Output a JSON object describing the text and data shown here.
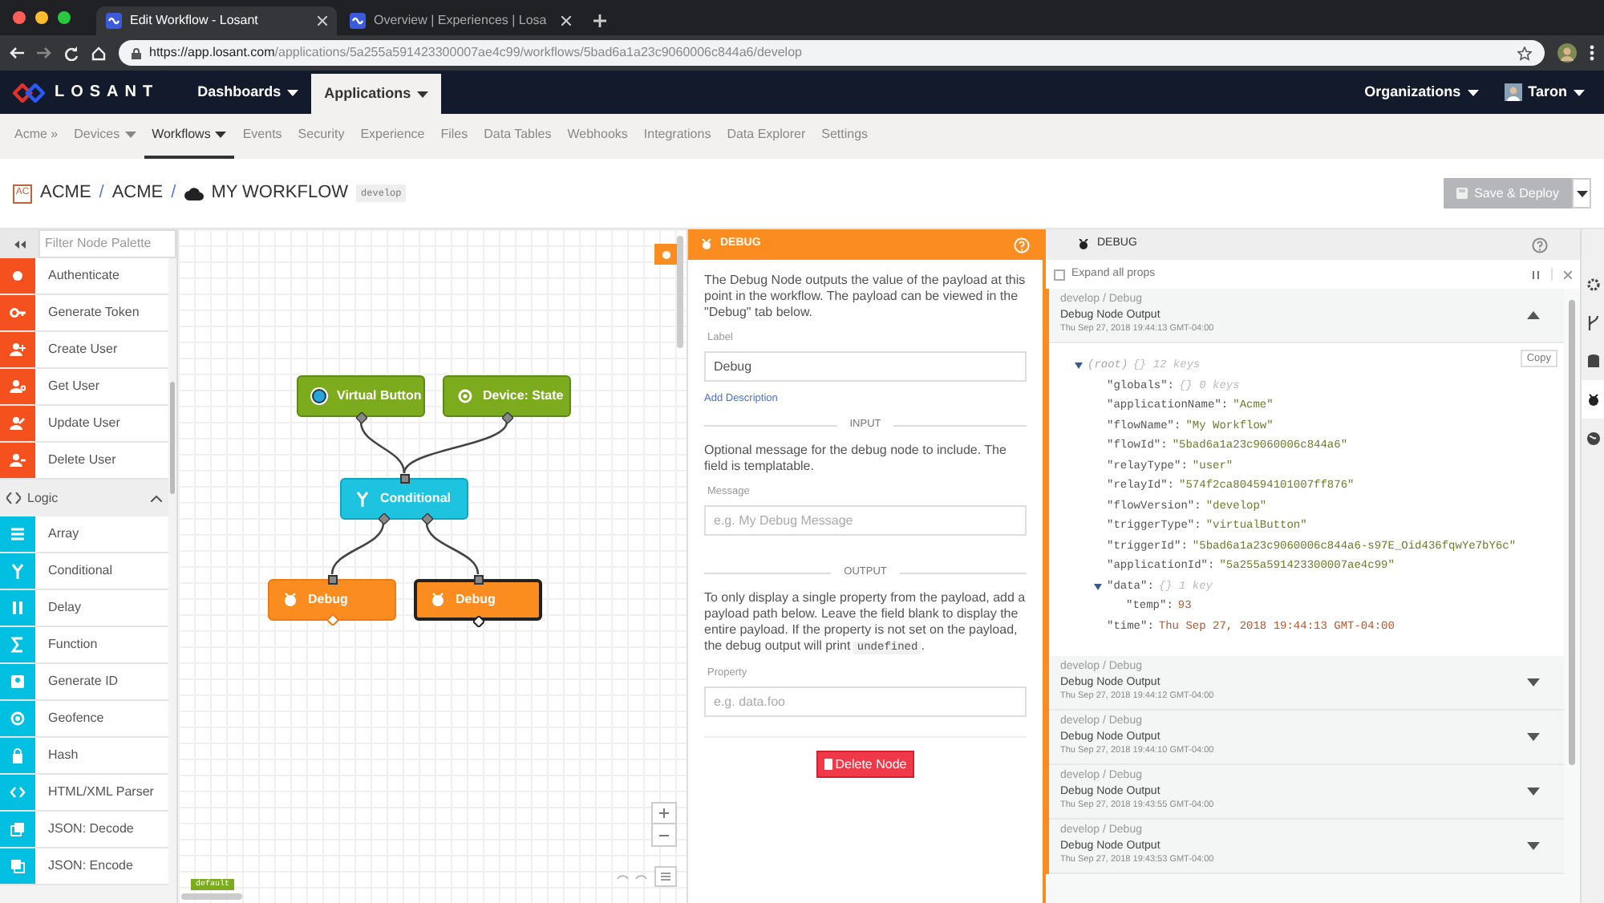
{
  "browser": {
    "tabs": [
      {
        "title": "Edit Workflow - Losant",
        "selected": true
      },
      {
        "title": "Overview | Experiences | Losa",
        "selected": false
      }
    ],
    "url_host": "https://app.losant.com",
    "url_path": "/applications/5a255a591423300007ae4c99/workflows/5bad6a1a23c9060006c844a6/develop"
  },
  "nav": {
    "logo": "LOSANT",
    "menus": [
      {
        "label": "Dashboards",
        "selected": false
      },
      {
        "label": "Applications",
        "selected": true
      }
    ],
    "organizations": "Organizations",
    "user": "Taron"
  },
  "subnav": [
    {
      "label": "Acme »",
      "dropdown": false,
      "selected": false
    },
    {
      "label": "Devices",
      "dropdown": true,
      "selected": false
    },
    {
      "label": "Workflows",
      "dropdown": true,
      "selected": true
    },
    {
      "label": "Events",
      "dropdown": false,
      "selected": false
    },
    {
      "label": "Security",
      "dropdown": false,
      "selected": false
    },
    {
      "label": "Experience",
      "dropdown": false,
      "selected": false
    },
    {
      "label": "Files",
      "dropdown": false,
      "selected": false
    },
    {
      "label": "Data Tables",
      "dropdown": false,
      "selected": false
    },
    {
      "label": "Webhooks",
      "dropdown": false,
      "selected": false
    },
    {
      "label": "Integrations",
      "dropdown": false,
      "selected": false
    },
    {
      "label": "Data Explorer",
      "dropdown": false,
      "selected": false
    },
    {
      "label": "Settings",
      "dropdown": false,
      "selected": false
    }
  ],
  "header": {
    "badge": "AC",
    "crumbs": [
      {
        "kind": "crumb",
        "text": "ACME"
      },
      {
        "kind": "separator",
        "text": "/"
      },
      {
        "kind": "crumb",
        "text": "ACME"
      },
      {
        "kind": "separator",
        "text": "/"
      },
      {
        "kind": "current",
        "text": "MY WORKFLOW"
      }
    ],
    "version": "develop",
    "save_button": {
      "label": "Save & Deploy",
      "disabled": true
    }
  },
  "palette": {
    "filter_placeholder": "Filter Node Palette",
    "rows": [
      {
        "kind": "node",
        "label": "Authenticate",
        "color": "#f4511e"
      },
      {
        "kind": "node",
        "label": "Generate Token",
        "color": "#f4511e"
      },
      {
        "kind": "node",
        "label": "Create User",
        "color": "#f4511e"
      },
      {
        "kind": "node",
        "label": "Get User",
        "color": "#f4511e"
      },
      {
        "kind": "node",
        "label": "Update User",
        "color": "#f4511e"
      },
      {
        "kind": "node",
        "label": "Delete User",
        "color": "#f4511e"
      },
      {
        "kind": "group",
        "label": "Logic",
        "expanded": true
      },
      {
        "kind": "node",
        "label": "Array",
        "color": "#00bfe0"
      },
      {
        "kind": "node",
        "label": "Conditional",
        "color": "#00bfe0"
      },
      {
        "kind": "node",
        "label": "Delay",
        "color": "#00bfe0"
      },
      {
        "kind": "node",
        "label": "Function",
        "color": "#00bfe0"
      },
      {
        "kind": "node",
        "label": "Generate ID",
        "color": "#00bfe0"
      },
      {
        "kind": "node",
        "label": "Geofence",
        "color": "#00bfe0"
      },
      {
        "kind": "node",
        "label": "Hash",
        "color": "#00bfe0"
      },
      {
        "kind": "node",
        "label": "HTML/XML Parser",
        "color": "#00bfe0"
      },
      {
        "kind": "node",
        "label": "JSON: Decode",
        "color": "#00bfe0"
      },
      {
        "kind": "node",
        "label": "JSON: Encode",
        "color": "#00bfe0"
      }
    ]
  },
  "canvas": {
    "nodes": [
      {
        "label": "Virtual Button",
        "kind": "trigger",
        "selected": false
      },
      {
        "label": "Device: State",
        "kind": "trigger",
        "selected": false
      },
      {
        "label": "Conditional",
        "kind": "logic",
        "selected": false
      },
      {
        "label": "Debug",
        "kind": "output",
        "selected": false
      },
      {
        "label": "Debug",
        "kind": "output",
        "selected": true
      }
    ],
    "version_tag": "default"
  },
  "node_panel": {
    "title": "DEBUG",
    "description": "The Debug Node outputs the value of the payload at this point in the workflow. The payload can be viewed in the \"Debug\" tab below.",
    "label_field": {
      "label": "Label",
      "value": "Debug"
    },
    "add_description": "Add Description",
    "input_heading": "INPUT",
    "input_text": "Optional message for the debug node to include. The field is templatable.",
    "message_field": {
      "label": "Message",
      "placeholder": "e.g. My Debug Message"
    },
    "output_heading": "OUTPUT",
    "output_text": {
      "before": "To only display a single property from the payload, add a payload path below. Leave the field blank to display the entire payload. If the property is not set on the payload, the debug output will print ",
      "code": "undefined",
      "after": "."
    },
    "property_field": {
      "label": "Property",
      "placeholder": "e.g. data.foo"
    },
    "delete_button": "Delete Node"
  },
  "debug_panel": {
    "title": "DEBUG",
    "expand_all": {
      "label": "Expand all props",
      "checked": false
    },
    "copy_button": "Copy",
    "entries": [
      {
        "path": "develop / Debug",
        "title": "Debug Node Output",
        "time": "Thu Sep 27, 2018 19:44:13 GMT-04:00",
        "expanded": true
      },
      {
        "path": "develop / Debug",
        "title": "Debug Node Output",
        "time": "Thu Sep 27, 2018 19:44:12 GMT-04:00",
        "expanded": false
      },
      {
        "path": "develop / Debug",
        "title": "Debug Node Output",
        "time": "Thu Sep 27, 2018 19:44:10 GMT-04:00",
        "expanded": false
      },
      {
        "path": "develop / Debug",
        "title": "Debug Node Output",
        "time": "Thu Sep 27, 2018 19:43:55 GMT-04:00",
        "expanded": false
      },
      {
        "path": "develop / Debug",
        "title": "Debug Node Output",
        "time": "Thu Sep 27, 2018 19:43:53 GMT-04:00",
        "expanded": false
      }
    ],
    "tree": {
      "key": "(root)",
      "summary": "{} 12 keys",
      "expanded": true,
      "children": [
        {
          "key": "\"globals\":",
          "summary": "{} 0 keys"
        },
        {
          "key": "\"applicationName\":",
          "value": "\"Acme\"",
          "kind": "string"
        },
        {
          "key": "\"flowName\":",
          "value": "\"My Workflow\"",
          "kind": "string"
        },
        {
          "key": "\"flowId\":",
          "value": "\"5bad6a1a23c9060006c844a6\"",
          "kind": "string"
        },
        {
          "key": "\"relayType\":",
          "value": "\"user\"",
          "kind": "string"
        },
        {
          "key": "\"relayId\":",
          "value": "\"574f2ca804594101007ff876\"",
          "kind": "string"
        },
        {
          "key": "\"flowVersion\":",
          "value": "\"develop\"",
          "kind": "string"
        },
        {
          "key": "\"triggerType\":",
          "value": "\"virtualButton\"",
          "kind": "string"
        },
        {
          "key": "\"triggerId\":",
          "value": "\"5bad6a1a23c9060006c844a6-s97E_Oid436fqwYe7bY6c\"",
          "kind": "string"
        },
        {
          "key": "\"applicationId\":",
          "value": "\"5a255a591423300007ae4c99\"",
          "kind": "string"
        },
        {
          "key": "\"data\":",
          "summary": "{} 1 key",
          "expanded": true,
          "children": [
            {
              "key": "\"temp\":",
              "value": "93",
              "kind": "number"
            }
          ]
        },
        {
          "key": "\"time\":",
          "value": "Thu Sep 27, 2018 19:44:13 GMT-04:00",
          "kind": "date"
        }
      ]
    }
  },
  "right_rail": [
    {
      "selected": false
    },
    {
      "selected": false
    },
    {
      "selected": false
    },
    {
      "selected": true
    },
    {
      "selected": false
    }
  ]
}
